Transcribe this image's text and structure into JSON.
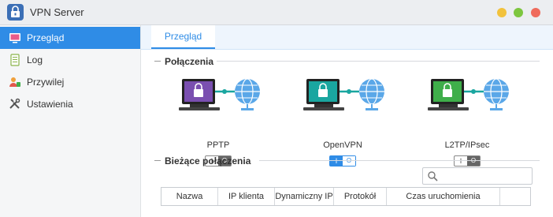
{
  "window": {
    "title": "VPN Server"
  },
  "sidebar": {
    "items": [
      {
        "label": "Przegląd",
        "icon": "overview-icon",
        "active": true
      },
      {
        "label": "Log",
        "icon": "log-icon",
        "active": false
      },
      {
        "label": "Przywilej",
        "icon": "privilege-icon",
        "active": false
      },
      {
        "label": "Ustawienia",
        "icon": "settings-icon",
        "active": false
      }
    ]
  },
  "main": {
    "tab": "Przegląd",
    "connections": {
      "heading": "Połączenia",
      "items": [
        {
          "label": "PPTP",
          "enabled": false,
          "screen_color": "#7a4fb0"
        },
        {
          "label": "OpenVPN",
          "enabled": true,
          "screen_color": "#1aa6a0"
        },
        {
          "label": "L2TP/IPsec",
          "enabled": false,
          "screen_color": "#3fae4a"
        }
      ]
    },
    "current": {
      "heading": "Bieżące połączenia",
      "search_placeholder": "",
      "columns": [
        "Nazwa",
        "IP klienta",
        "Dynamiczny IP",
        "Protokół",
        "Czas uruchomienia",
        ""
      ]
    }
  },
  "colors": {
    "accent": "#2f8ce6",
    "sidebar_bg": "#f5f6f7"
  }
}
